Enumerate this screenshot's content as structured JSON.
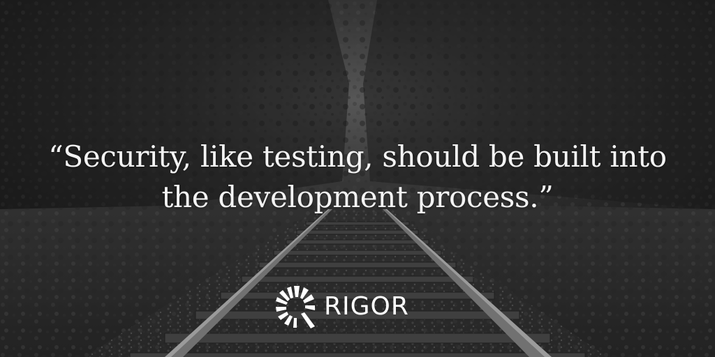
{
  "quote": {
    "line1": "“Security, like testing, should be built into",
    "line2": "the development process.”"
  },
  "logo": {
    "wordmark": "RIGOR",
    "icon": "rigor-mark-icon"
  },
  "background": {
    "description_icon": "railway-forest-photo",
    "tint": "#3a3a3a"
  }
}
